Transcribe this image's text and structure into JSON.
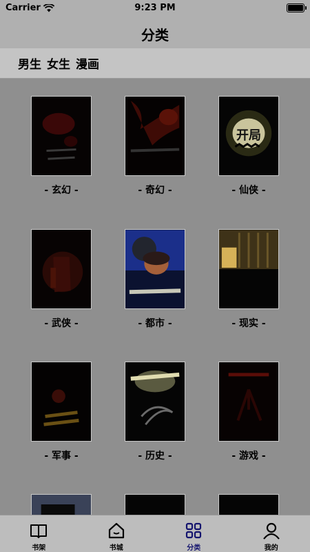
{
  "status_bar": {
    "carrier": "Carrier",
    "time": "9:23 PM"
  },
  "nav": {
    "title": "分类"
  },
  "gender_tabs": [
    "男生",
    "女生",
    "漫画"
  ],
  "categories": [
    {
      "label": "- 玄幻 -",
      "cover_text": ""
    },
    {
      "label": "- 奇幻 -",
      "cover_text": ""
    },
    {
      "label": "- 仙侠 -",
      "cover_text": "开局"
    },
    {
      "label": "- 武侠 -",
      "cover_text": ""
    },
    {
      "label": "- 都市 -",
      "cover_text": ""
    },
    {
      "label": "- 现实 -",
      "cover_text": ""
    },
    {
      "label": "- 军事 -",
      "cover_text": ""
    },
    {
      "label": "- 历史 -",
      "cover_text": ""
    },
    {
      "label": "- 游戏 -",
      "cover_text": ""
    }
  ],
  "tab_bar": {
    "items": [
      {
        "label": "书架",
        "icon": "book-icon"
      },
      {
        "label": "书城",
        "icon": "home-icon"
      },
      {
        "label": "分类",
        "icon": "grid-icon"
      },
      {
        "label": "我的",
        "icon": "user-icon"
      }
    ],
    "active_index": 2,
    "active_color": "#14146e"
  }
}
